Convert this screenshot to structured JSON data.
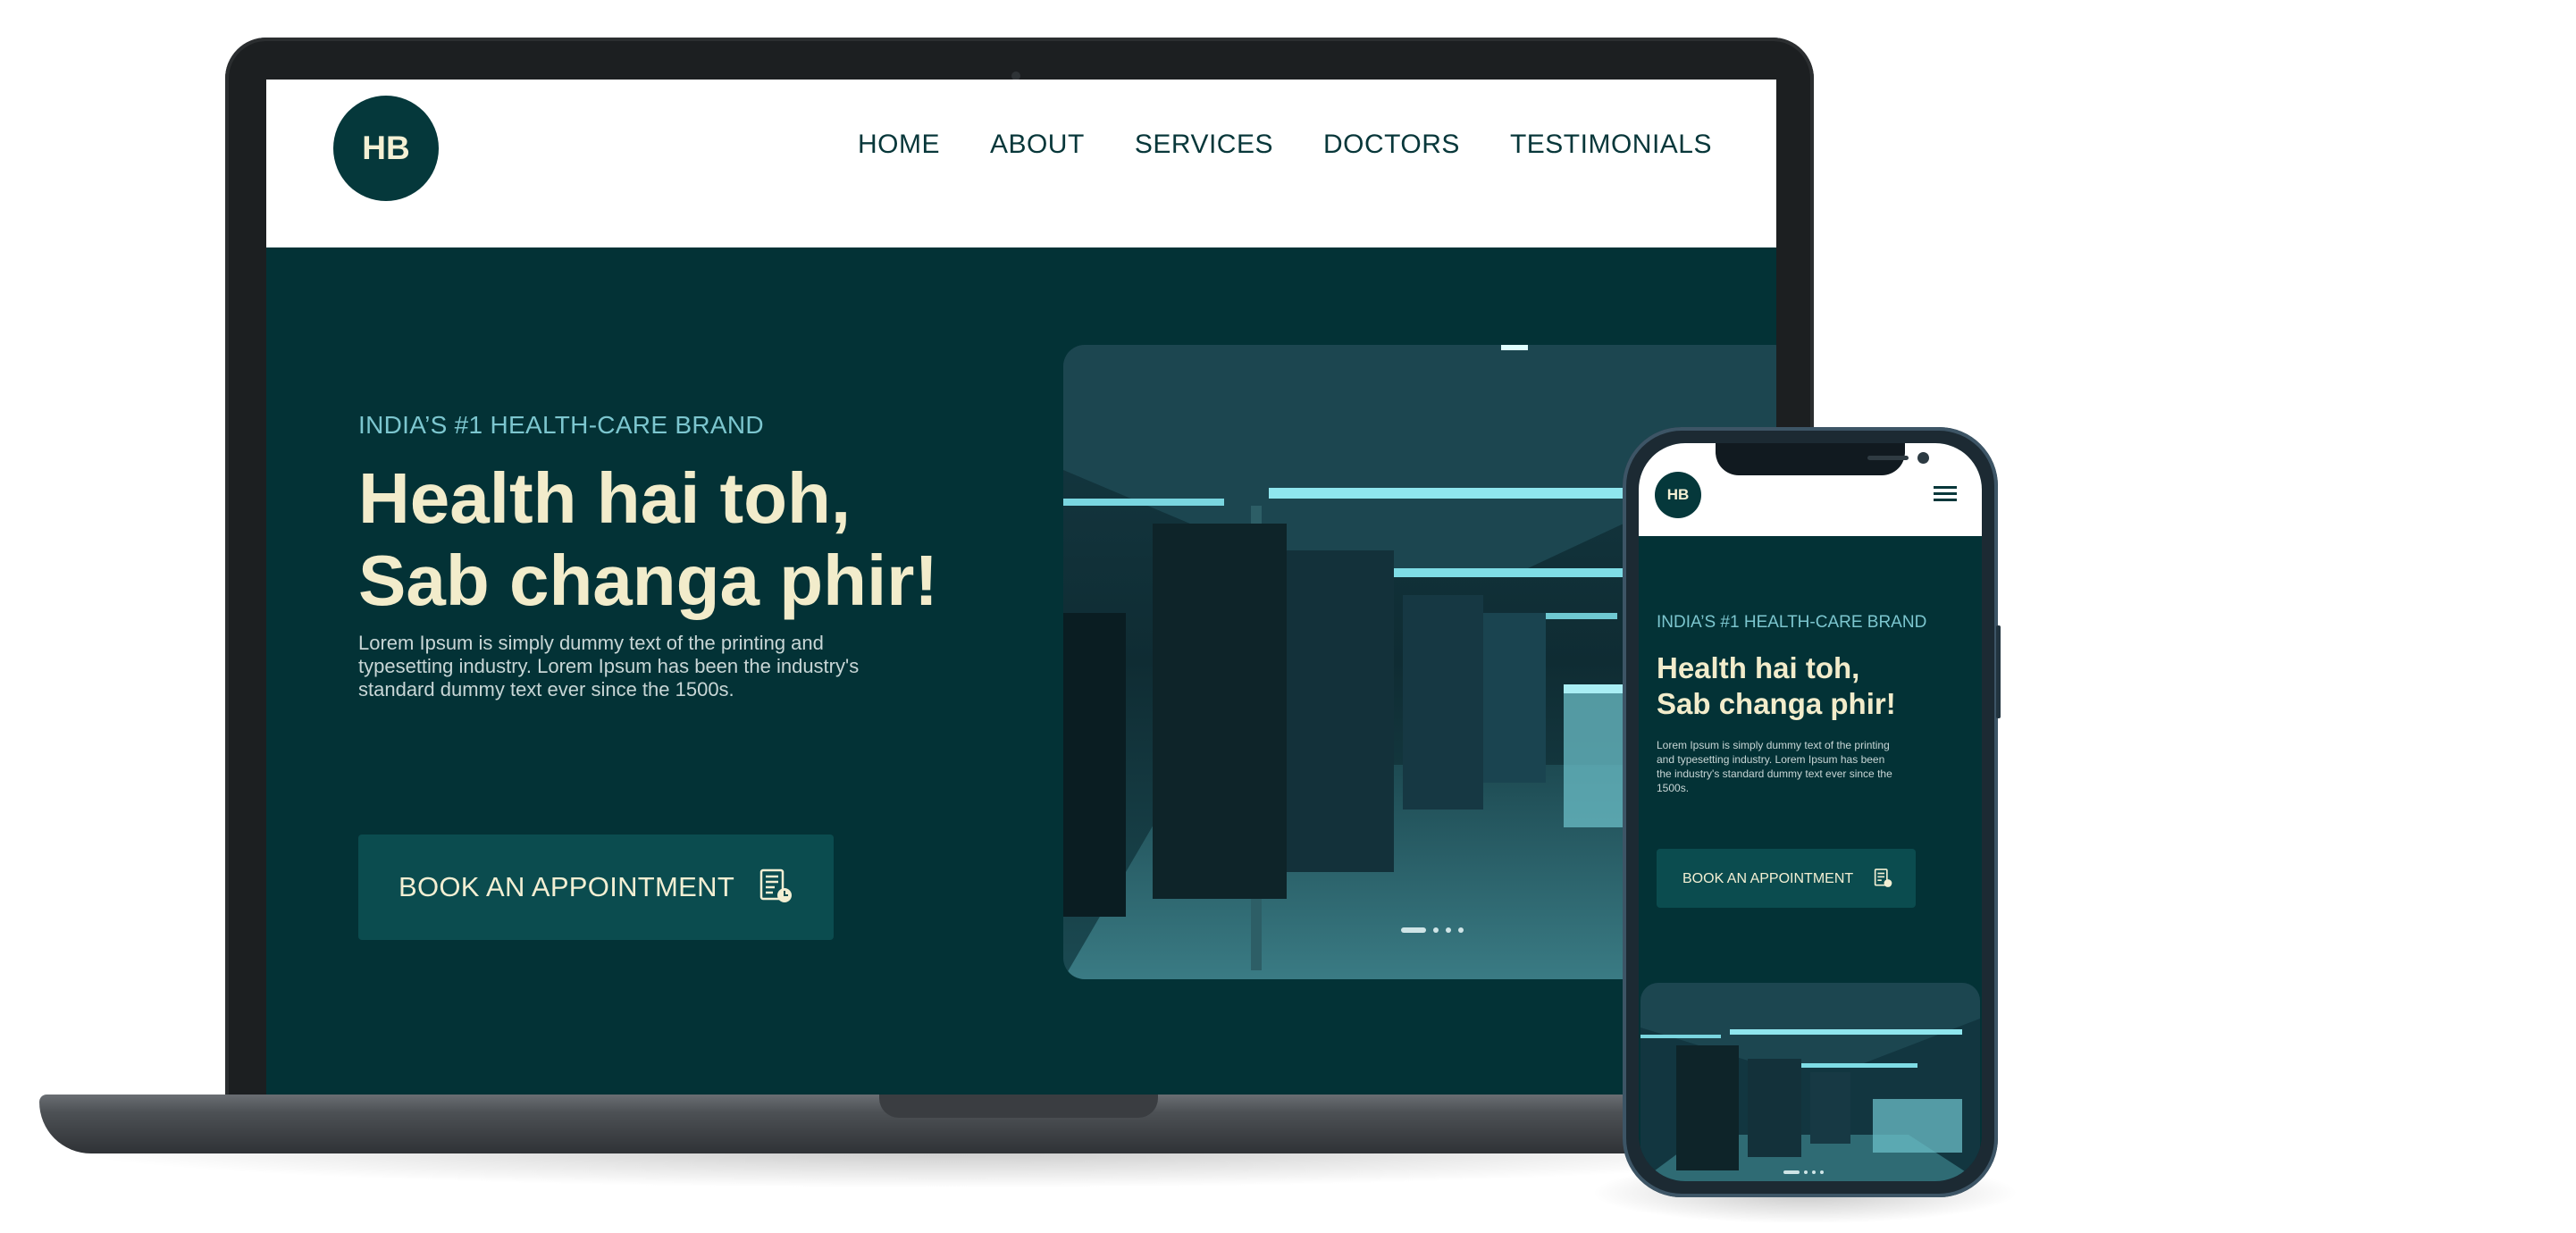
{
  "brand": {
    "logo_text": "HB"
  },
  "nav": {
    "items": [
      "HOME",
      "ABOUT",
      "SERVICES",
      "DOCTORS",
      "TESTIMONIALS"
    ]
  },
  "hero": {
    "kicker": "INDIA’S #1 HEALTH-CARE BRAND",
    "title_line1": "Health hai toh,",
    "title_line2": "Sab changa phir!",
    "description": "Lorem Ipsum is simply dummy text of the printing and typesetting industry. Lorem Ipsum has been the industry's standard dummy text ever since the 1500s.",
    "cta_label": "BOOK AN APPOINTMENT",
    "cta_icon": "appointment-calendar-icon",
    "image": "hospital-corridor-photo",
    "carousel": {
      "slides": 4,
      "active": 1
    }
  },
  "mobile": {
    "menu_icon": "hamburger-menu-icon"
  },
  "colors": {
    "primary_dark": "#033236",
    "logo_bg": "#05383b",
    "accent_cream": "#f2eccb",
    "kicker_teal": "#7cc6cf",
    "button_bg": "#0b4c4f",
    "nav_text": "#08373a"
  }
}
